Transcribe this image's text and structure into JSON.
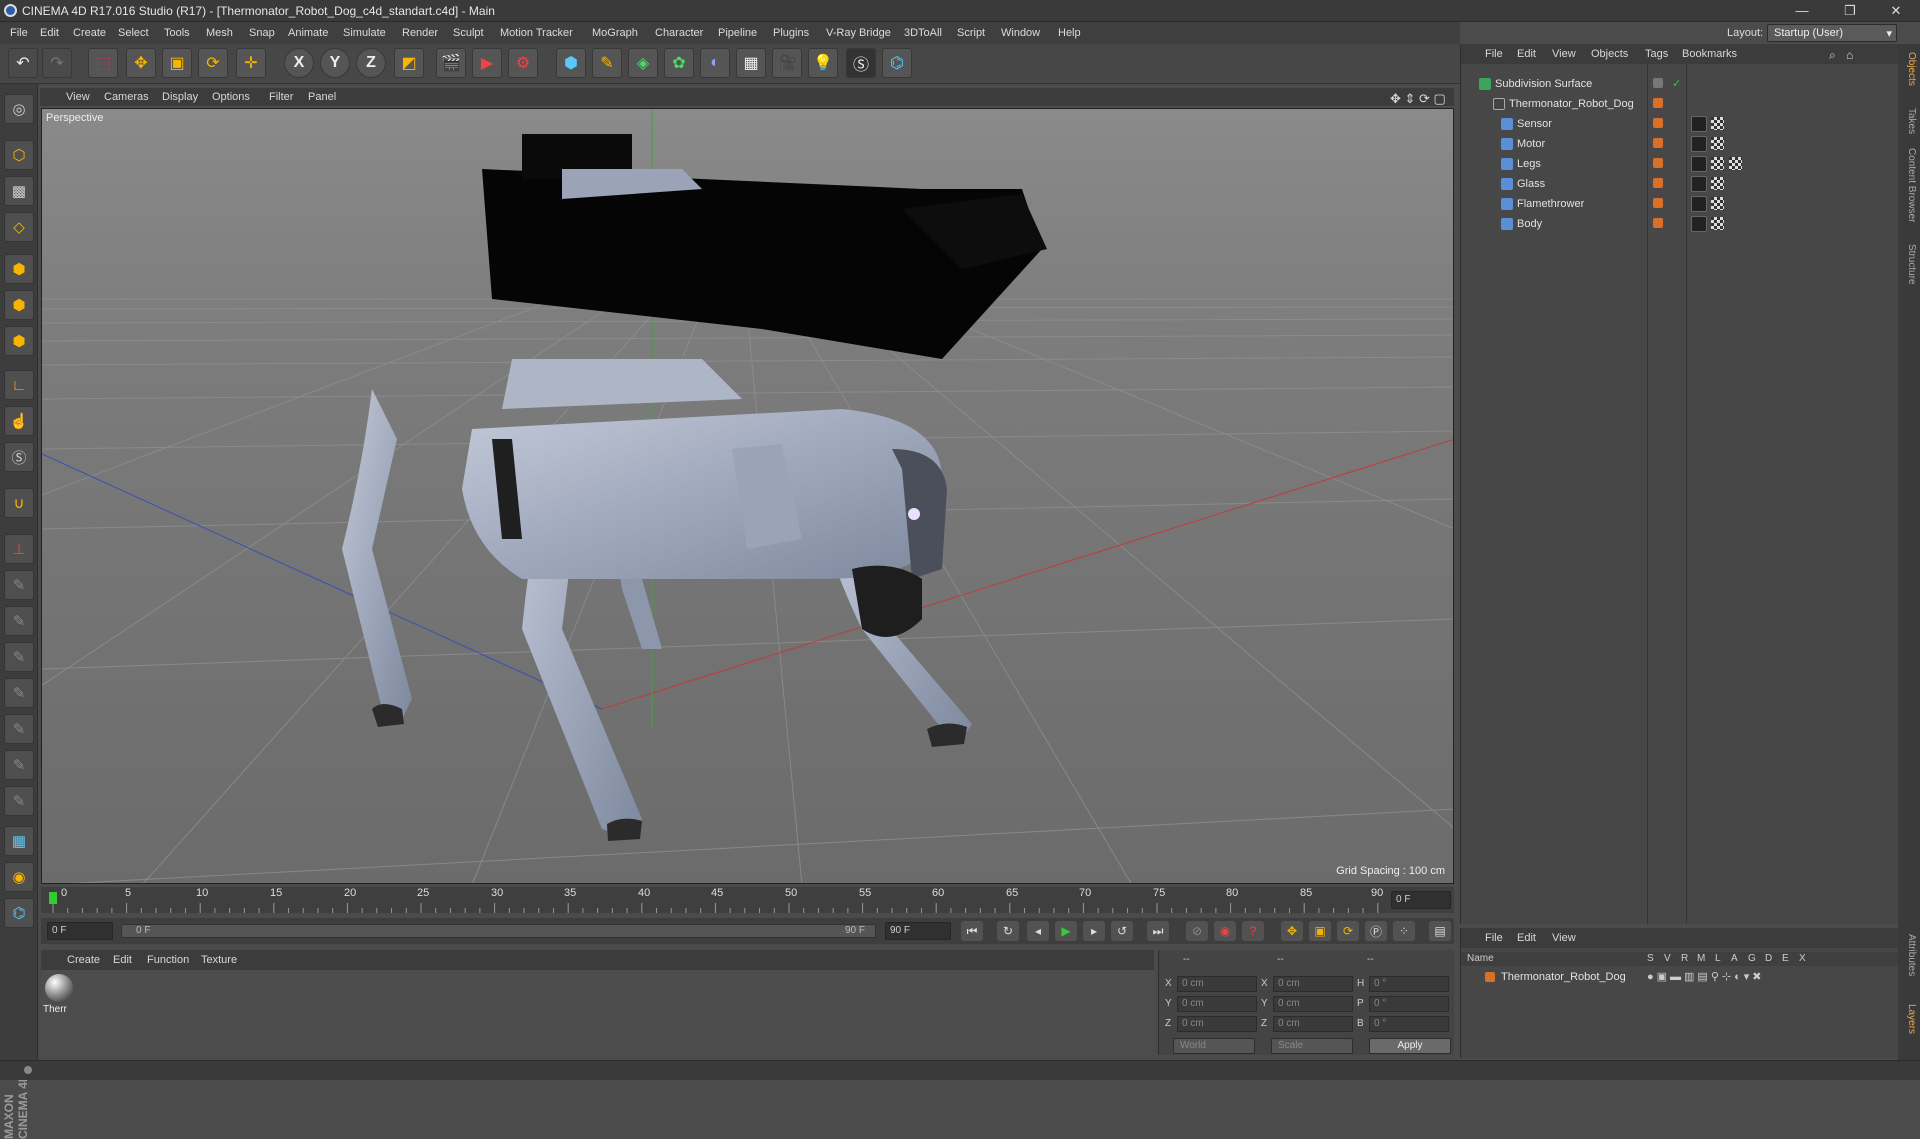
{
  "window": {
    "title": "CINEMA 4D R17.016 Studio (R17) - [Thermonator_Robot_Dog_c4d_standart.c4d] - Main",
    "minimize": "—",
    "restore": "❐",
    "close": "✕"
  },
  "menu": [
    "File",
    "Edit",
    "Create",
    "Select",
    "Tools",
    "Mesh",
    "Snap",
    "Animate",
    "Simulate",
    "Render",
    "Sculpt",
    "Motion Tracker",
    "MoGraph",
    "Character",
    "Pipeline",
    "Plugins",
    "V-Ray Bridge",
    "3DToAll",
    "Script",
    "Window",
    "Help"
  ],
  "layout": {
    "label": "Layout:",
    "value": "Startup (User)"
  },
  "toolbar": {
    "icons": [
      "undo-icon",
      "redo-icon",
      "select-icon",
      "move-icon",
      "scale-icon",
      "rotate-icon",
      "transform-icon",
      "x-axis-icon",
      "y-axis-icon",
      "z-axis-icon",
      "coordinate-system-icon",
      "render-view-icon",
      "render-picture-icon",
      "render-settings-icon",
      "cube-icon",
      "pen-icon",
      "subdivision-icon",
      "array-icon",
      "deformer-icon",
      "floor-icon",
      "camera-icon",
      "light-icon",
      "python-generator-icon",
      "python-icon"
    ],
    "axis_labels": [
      "X",
      "Y",
      "Z"
    ]
  },
  "viewport": {
    "menu": [
      "View",
      "Cameras",
      "Display",
      "Options",
      "Filter",
      "Panel"
    ],
    "label": "Perspective",
    "grid_spacing": "Grid Spacing : 100 cm"
  },
  "timeline": {
    "ticks": [
      "0",
      "5",
      "10",
      "15",
      "20",
      "25",
      "30",
      "35",
      "40",
      "45",
      "50",
      "55",
      "60",
      "65",
      "70",
      "75",
      "80",
      "85",
      "90"
    ],
    "current_frame": "0 F",
    "start_frame": "0 F",
    "range_start": "0 F",
    "range_end": "90 F",
    "end_frame": "90 F"
  },
  "material_manager": {
    "menu": [
      "Create",
      "Edit",
      "Function",
      "Texture"
    ],
    "material_name": "Therr"
  },
  "coordinates": {
    "headers": [
      "--",
      "--",
      "--"
    ],
    "rows": [
      {
        "axis": "X",
        "pos": "0 cm",
        "size_axis": "X",
        "size": "0 cm",
        "rot_axis": "H",
        "rot": "0 °"
      },
      {
        "axis": "Y",
        "pos": "0 cm",
        "size_axis": "Y",
        "size": "0 cm",
        "rot_axis": "P",
        "rot": "0 °"
      },
      {
        "axis": "Z",
        "pos": "0 cm",
        "size_axis": "Z",
        "size": "0 cm",
        "rot_axis": "B",
        "rot": "0 °"
      }
    ],
    "world": "World",
    "scale": "Scale",
    "apply": "Apply"
  },
  "object_manager": {
    "menu": [
      "File",
      "Edit",
      "View",
      "Objects",
      "Tags",
      "Bookmarks"
    ],
    "objects": [
      {
        "name": "Subdivision Surface",
        "level": 0
      },
      {
        "name": "Thermonator_Robot_Dog",
        "level": 1
      },
      {
        "name": "Sensor",
        "level": 2
      },
      {
        "name": "Motor",
        "level": 2
      },
      {
        "name": "Legs",
        "level": 2
      },
      {
        "name": "Glass",
        "level": 2
      },
      {
        "name": "Flamethrower",
        "level": 2
      },
      {
        "name": "Body",
        "level": 2
      }
    ]
  },
  "layer_manager": {
    "menu": [
      "File",
      "Edit",
      "View"
    ],
    "columns": [
      "Name",
      "S",
      "V",
      "R",
      "M",
      "L",
      "A",
      "G",
      "D",
      "E",
      "X"
    ],
    "layers": [
      {
        "name": "Thermonator_Robot_Dog"
      }
    ]
  },
  "side_tabs": [
    "Objects",
    "Takes",
    "Content Browser",
    "Structure",
    "Attributes",
    "Layers"
  ],
  "maxon": "MAXON CINEMA 4D",
  "colors": {
    "accent": "#d8702a",
    "x_axis": "#c23a3a",
    "y_axis": "#3fa33f",
    "z_axis": "#3b4fb5"
  }
}
